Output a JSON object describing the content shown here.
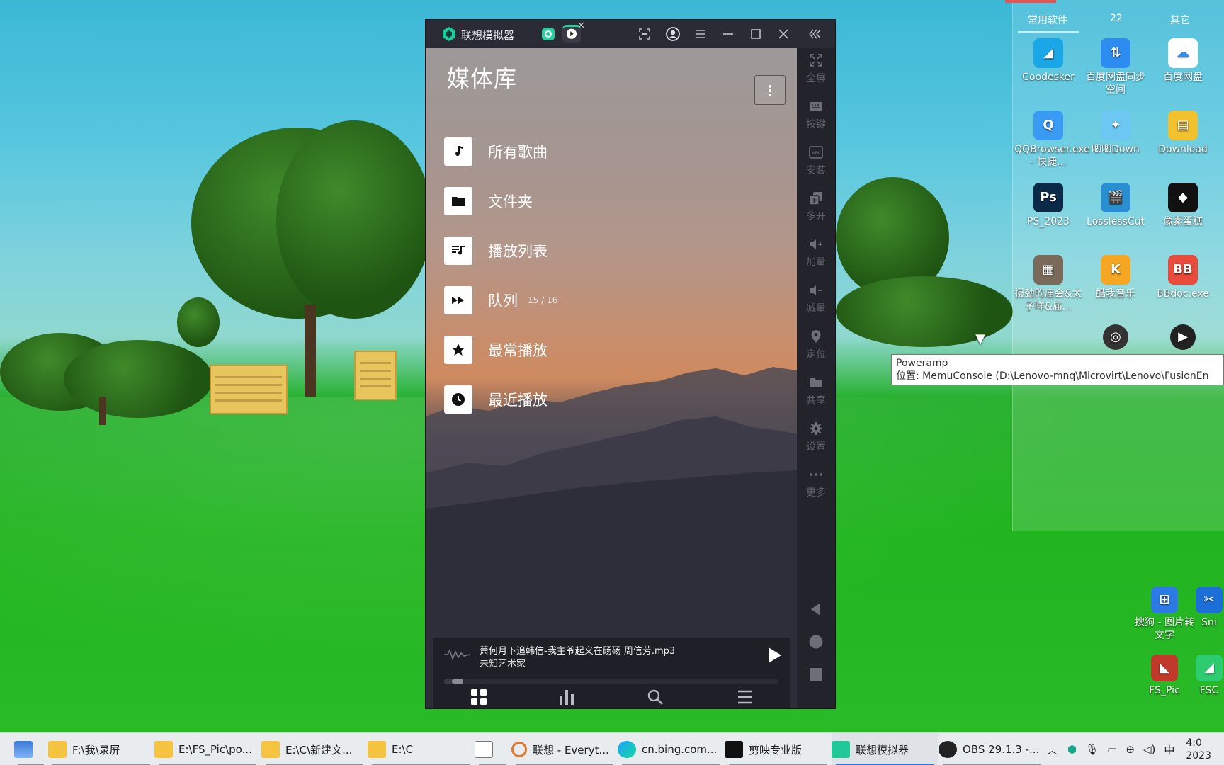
{
  "emulator": {
    "title": "联想模拟器",
    "side_menu": [
      {
        "label": "全屏",
        "icon": "fullscreen-icon"
      },
      {
        "label": "按键",
        "icon": "keyboard-icon"
      },
      {
        "label": "安装",
        "icon": "apk-install-icon"
      },
      {
        "label": "多开",
        "icon": "multi-instance-icon"
      },
      {
        "label": "加量",
        "icon": "volume-up-icon"
      },
      {
        "label": "减量",
        "icon": "volume-down-icon"
      },
      {
        "label": "定位",
        "icon": "location-icon"
      },
      {
        "label": "共享",
        "icon": "shared-folder-icon"
      },
      {
        "label": "设置",
        "icon": "settings-gear-icon"
      },
      {
        "label": "更多",
        "icon": "more-dots-icon"
      }
    ]
  },
  "app": {
    "page_title": "媒体库",
    "library_items": [
      {
        "label": "所有歌曲",
        "icon": "music-note-icon",
        "count": ""
      },
      {
        "label": "文件夹",
        "icon": "folder-icon",
        "count": ""
      },
      {
        "label": "播放列表",
        "icon": "playlist-icon",
        "count": ""
      },
      {
        "label": "队列",
        "icon": "queue-forward-icon",
        "count": "15 / 16"
      },
      {
        "label": "最常播放",
        "icon": "star-icon",
        "count": ""
      },
      {
        "label": "最近播放",
        "icon": "clock-icon",
        "count": ""
      }
    ],
    "now_playing": {
      "track": "萧何月下追韩信-我主爷起义在砀砀 周信芳.mp3",
      "artist": "未知艺术家",
      "progress": 0.04
    }
  },
  "desktop": {
    "fence_tabs": [
      "常用软件",
      "22",
      "其它"
    ],
    "icons": [
      {
        "label": "Coodesker",
        "color": "#1aa7e8",
        "glyph": "◢"
      },
      {
        "label": "百度网盘同步空间",
        "color": "#2d8cf0",
        "glyph": "⇅"
      },
      {
        "label": "百度网盘",
        "color": "#ffffff",
        "glyph": "☁"
      },
      {
        "label": "QQBrowser.exe - 快捷...",
        "color": "#3a9bf4",
        "glyph": "Q"
      },
      {
        "label": "唧唧Down",
        "color": "#6cc7f2",
        "glyph": "✦"
      },
      {
        "label": "Download",
        "color": "#f2c12e",
        "glyph": "▤"
      },
      {
        "label": "PS_2023",
        "color": "#0b2a4a",
        "glyph": "Ps"
      },
      {
        "label": "LosslessCut",
        "color": "#2a8fd1",
        "glyph": "🎬"
      },
      {
        "label": "像素蛋糕",
        "color": "#111111",
        "glyph": "◆"
      },
      {
        "label": "摄劲的庙会&太子咩&庙...",
        "color": "#7a6a5a",
        "glyph": "▦"
      },
      {
        "label": "酷我音乐",
        "color": "#f5a623",
        "glyph": "K"
      },
      {
        "label": "BBdoc.exe",
        "color": "#e94b3c",
        "glyph": "BB"
      }
    ],
    "lower_icons": [
      {
        "label": "搜狗 - 图片转文字",
        "color": "#2c7be5",
        "glyph": "⊞"
      },
      {
        "label": "Sni",
        "color": "#1d6fd8",
        "glyph": "✂"
      },
      {
        "label": "FS_Pic",
        "color": "#c0392b",
        "glyph": "◣"
      },
      {
        "label": "FSC",
        "color": "#2ecc71",
        "glyph": "◢"
      }
    ],
    "tooltip": {
      "name": "Poweramp",
      "location": "位置: MemuConsole (D:\\Lenovo-mnq\\Microvirt\\Lenovo\\FusionEn"
    }
  },
  "taskbar": {
    "items": [
      {
        "label": "",
        "kind": "monitor"
      },
      {
        "label": "F:\\我\\录屏",
        "kind": "folder"
      },
      {
        "label": "E:\\FS_Pic\\po...",
        "kind": "folder"
      },
      {
        "label": "E:\\C\\新建文...",
        "kind": "folder"
      },
      {
        "label": "E:\\C",
        "kind": "folder"
      },
      {
        "label": "",
        "kind": "notepad"
      },
      {
        "label": "联想 - Everyt...",
        "kind": "everything"
      },
      {
        "label": "cn.bing.com...",
        "kind": "edge"
      },
      {
        "label": "剪映专业版",
        "kind": "capcut"
      },
      {
        "label": "联想模拟器",
        "kind": "emulator"
      },
      {
        "label": "OBS 29.1.3 -...",
        "kind": "obs"
      }
    ],
    "ime": "中",
    "time": "4:0",
    "date": "2023"
  }
}
